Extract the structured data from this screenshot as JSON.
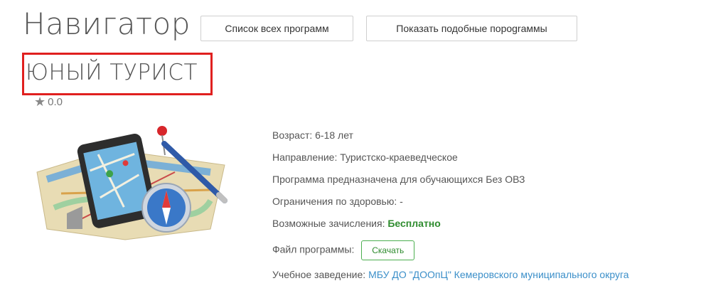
{
  "page": {
    "title": "Навигатор"
  },
  "toolbar": {
    "all_programs_label": "Список всех программ",
    "similar_programs_label": "Показать подобные пороgraммы"
  },
  "program": {
    "title": "ЮНЫЙ ТУРИСТ",
    "rating": "0.0",
    "age": "Возраст: 6-18 лет",
    "direction": "Направление: Туристско-краеведческое",
    "audience": "Программа предназначена для обучающихся Без ОВЗ",
    "health": "Ограничения по здоровью: -",
    "enrollment_label": "Возможные зачисления: ",
    "enrollment_value": "Бесплатно",
    "file_label": "Файл программы:",
    "download_label": "Скачать",
    "school_label": "Учебное заведение: ",
    "school_value": "МБУ ДО \"ДООпЦ\" Кемеровского муниципального округа"
  },
  "colors": {
    "highlight": "#e0201f",
    "green": "#2f8c2f",
    "link": "#3b8fc9"
  },
  "icons": {
    "rating": "star-icon"
  }
}
